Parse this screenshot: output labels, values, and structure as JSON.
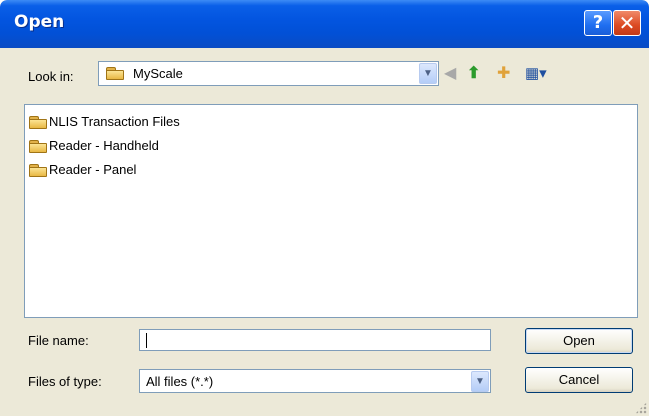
{
  "window": {
    "title": "Open",
    "help_glyph": "?",
    "close_glyph": "✕"
  },
  "lookin": {
    "label": "Look in:",
    "value": "MyScale",
    "icon": "folder-icon"
  },
  "toolbar": {
    "back_glyph": "◀",
    "up_glyph": "⬆",
    "new_folder_glyph": "✚",
    "views_glyph": "▦▾"
  },
  "files": [
    {
      "name": "NLIS Transaction Files",
      "icon": "folder-icon"
    },
    {
      "name": "Reader - Handheld",
      "icon": "folder-icon"
    },
    {
      "name": "Reader - Panel",
      "icon": "folder-icon"
    }
  ],
  "filename": {
    "label": "File name:",
    "value": ""
  },
  "filetype": {
    "label": "Files of type:",
    "value": "All files (*.*)"
  },
  "buttons": {
    "open": "Open",
    "cancel": "Cancel"
  }
}
